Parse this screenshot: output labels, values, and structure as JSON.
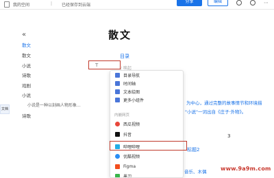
{
  "topbar": {
    "space_label": "我的空间",
    "divider": "|",
    "save_status": "已经保存到云端",
    "share_label": "分享",
    "edit_label": "编辑"
  },
  "sidebar": {
    "collapse_glyph": "«",
    "items": [
      {
        "label": "散文"
      },
      {
        "label": "散文"
      },
      {
        "label": "小说"
      },
      {
        "label": "诗歌"
      },
      {
        "label": "戏剧"
      },
      {
        "label": "小说"
      },
      {
        "label": "小说是一种以刻画人物形象..."
      },
      {
        "label": "诗歌"
      }
    ],
    "left_tab_label": "文档"
  },
  "main": {
    "title": "散文",
    "toc_link": "目录",
    "insert_glyph": "T",
    "insert_hint": "/ 唤起",
    "para_lines": [
      "为中心，通过完整的故事情节和环境描",
      "\"小说\"一词出自《庄子·外物》。"
    ],
    "number_three": "3",
    "heading2": "标题2",
    "tail_text": "音乐、木偶",
    "watermark": "www.9a9m.com"
  },
  "dropdown": {
    "items": [
      {
        "label": "目录导航",
        "icon": "toc-icon",
        "color": "#4a76d9"
      },
      {
        "label": "时间轴",
        "icon": "timeline-icon",
        "color": "#4a76d9"
      },
      {
        "label": "文本绘图",
        "icon": "drawing-icon",
        "color": "#4a76d9"
      },
      {
        "label": "更多小组件",
        "icon": "widget-icon",
        "color": "#4a76d9"
      }
    ],
    "section_label": "内嵌网页",
    "embed_items": [
      {
        "label": "西瓜视频",
        "icon": "xigua-icon",
        "color": "#e8473a"
      },
      {
        "label": "抖音",
        "icon": "douyin-icon",
        "color": "#111111"
      },
      {
        "label": "哔哩哔哩",
        "icon": "bilibili-icon",
        "color": "#23ade5"
      },
      {
        "label": "优酷视频",
        "icon": "youku-icon",
        "color": "#2a8ef5"
      },
      {
        "label": "Figma",
        "icon": "figma-icon",
        "color": "#f24e1e"
      },
      {
        "label": "墨刀",
        "icon": "modao-icon",
        "color": "#3ab54a"
      }
    ]
  },
  "colors": {
    "accent": "#1a73e8",
    "highlight": "#c0392b"
  }
}
